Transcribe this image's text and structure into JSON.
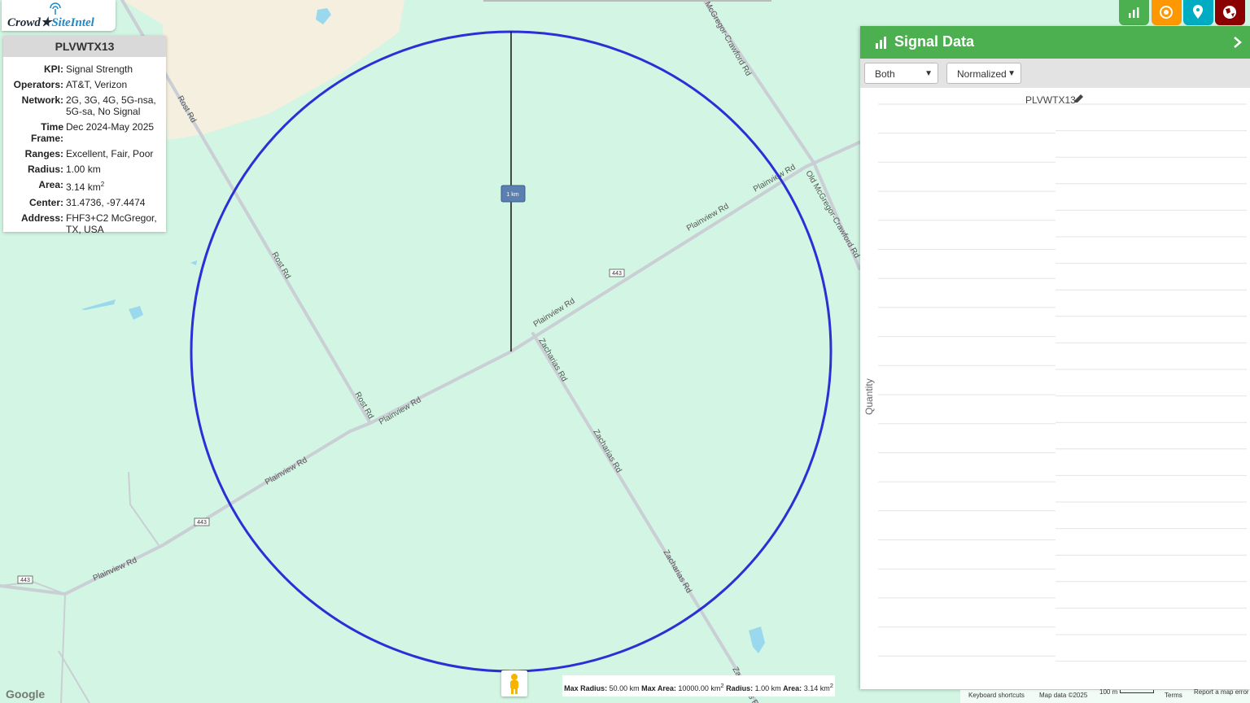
{
  "logo": {
    "part1": "Crowd",
    "part2": "SiteIntel"
  },
  "info": {
    "title": "PLVWTX13",
    "rows": [
      {
        "k": "KPI:",
        "v": "Signal Strength"
      },
      {
        "k": "Operators:",
        "v": "AT&T, Verizon"
      },
      {
        "k": "Network:",
        "v": "2G, 3G, 4G, 5G-nsa, 5G-sa, No Signal"
      },
      {
        "k": "Time Frame:",
        "v": "Dec 2024-May 2025"
      },
      {
        "k": "Ranges:",
        "v": "Excellent, Fair, Poor"
      },
      {
        "k": "Radius:",
        "v": "1.00 km"
      },
      {
        "k": "Area:",
        "v": "3.14 km",
        "sup": "2"
      },
      {
        "k": "Center:",
        "v": "31.4736, -97.4474"
      },
      {
        "k": "Address:",
        "v": "FHF3+C2 McGregor, TX, USA"
      }
    ]
  },
  "toolbar": {
    "colors": [
      "#4caf50",
      "#ff9800",
      "#00acc1",
      "#8b0000"
    ],
    "icons": [
      "bar-chart-icon",
      "target-icon",
      "map-pin-icon",
      "globe-icon"
    ]
  },
  "panel": {
    "title": "Signal Data",
    "select1": "Both",
    "select2": "Normalized",
    "chart_title": "PLVWTX13",
    "ylabel": "Quantity"
  },
  "map": {
    "roads": [
      "Rost Rd",
      "Rost Rd",
      "Rost Rd",
      "Plainview Rd",
      "Plainview Rd",
      "Plainview Rd",
      "Plainview Rd",
      "Plainview Rd",
      "Plainview Rd",
      "Zacharias Rd",
      "Zacharias Rd",
      "Zacharias Rd",
      "Zacharias Rd",
      "McGregor-Crawford Rd",
      "Old McGregor-Crawford Rd"
    ],
    "shields": [
      "443",
      "443",
      "443"
    ],
    "scale_label": "1 km"
  },
  "legend": {
    "k1": "Max Radius:",
    "v1": "50.00 km",
    "k2": "Max Area:",
    "v2": "10000.00 km",
    "k3": "Radius:",
    "v3": "1.00 km",
    "k4": "Area:",
    "v4": "3.14 km",
    "sup": "2"
  },
  "footer": {
    "keyboard": "Keyboard shortcuts",
    "mapdata": "Map data ©2025",
    "scale": "100 m",
    "terms": "Terms",
    "report": "Report a map error",
    "google": "Google"
  }
}
